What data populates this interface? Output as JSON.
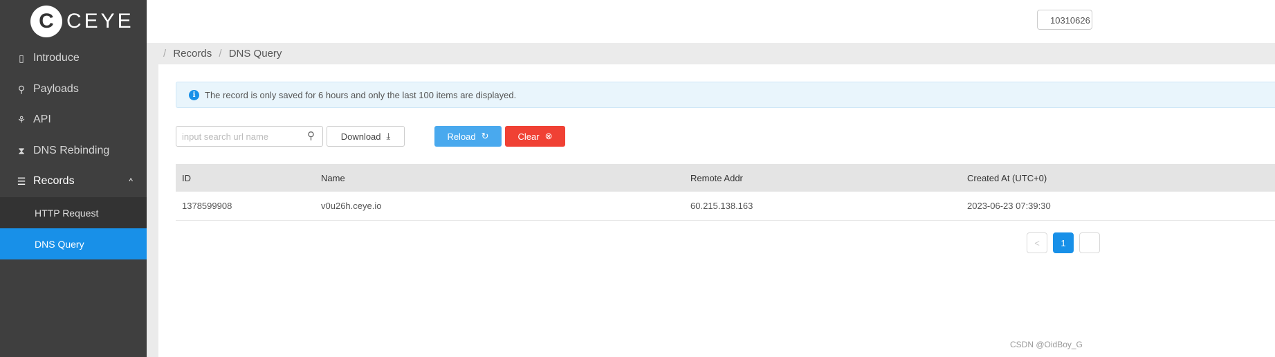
{
  "brand": {
    "logo_letter": "C",
    "name": "CEYE"
  },
  "sidebar": {
    "items": [
      {
        "label": "Introduce",
        "icon": "book-icon"
      },
      {
        "label": "Payloads",
        "icon": "rocket-icon"
      },
      {
        "label": "API",
        "icon": "api-icon"
      },
      {
        "label": "DNS Rebinding",
        "icon": "hourglass-icon"
      },
      {
        "label": "Records",
        "icon": "list-icon",
        "expanded": true,
        "children": [
          {
            "label": "HTTP Request"
          },
          {
            "label": "DNS Query",
            "active": true
          }
        ]
      }
    ]
  },
  "header": {
    "user_id": "10310626"
  },
  "breadcrumb": [
    "Records",
    "DNS Query"
  ],
  "alert": {
    "text": "The record is only saved for 6 hours and only the last 100 items are displayed."
  },
  "toolbar": {
    "search_placeholder": "input search url name",
    "download": "Download",
    "reload": "Reload",
    "clear": "Clear"
  },
  "table": {
    "columns": [
      "ID",
      "Name",
      "Remote Addr",
      "Created At (UTC+0)"
    ],
    "rows": [
      [
        "1378599908",
        "v0u26h.ceye.io",
        "60.215.138.163",
        "2023-06-23 07:39:30"
      ]
    ]
  },
  "pagination": {
    "prev": "<",
    "current": "1"
  },
  "watermark": "CSDN @OidBoy_G",
  "colors": {
    "sidebar": "#3f3f3f",
    "accent": "#1890e8",
    "reload": "#49a9ee",
    "clear": "#f04134"
  }
}
